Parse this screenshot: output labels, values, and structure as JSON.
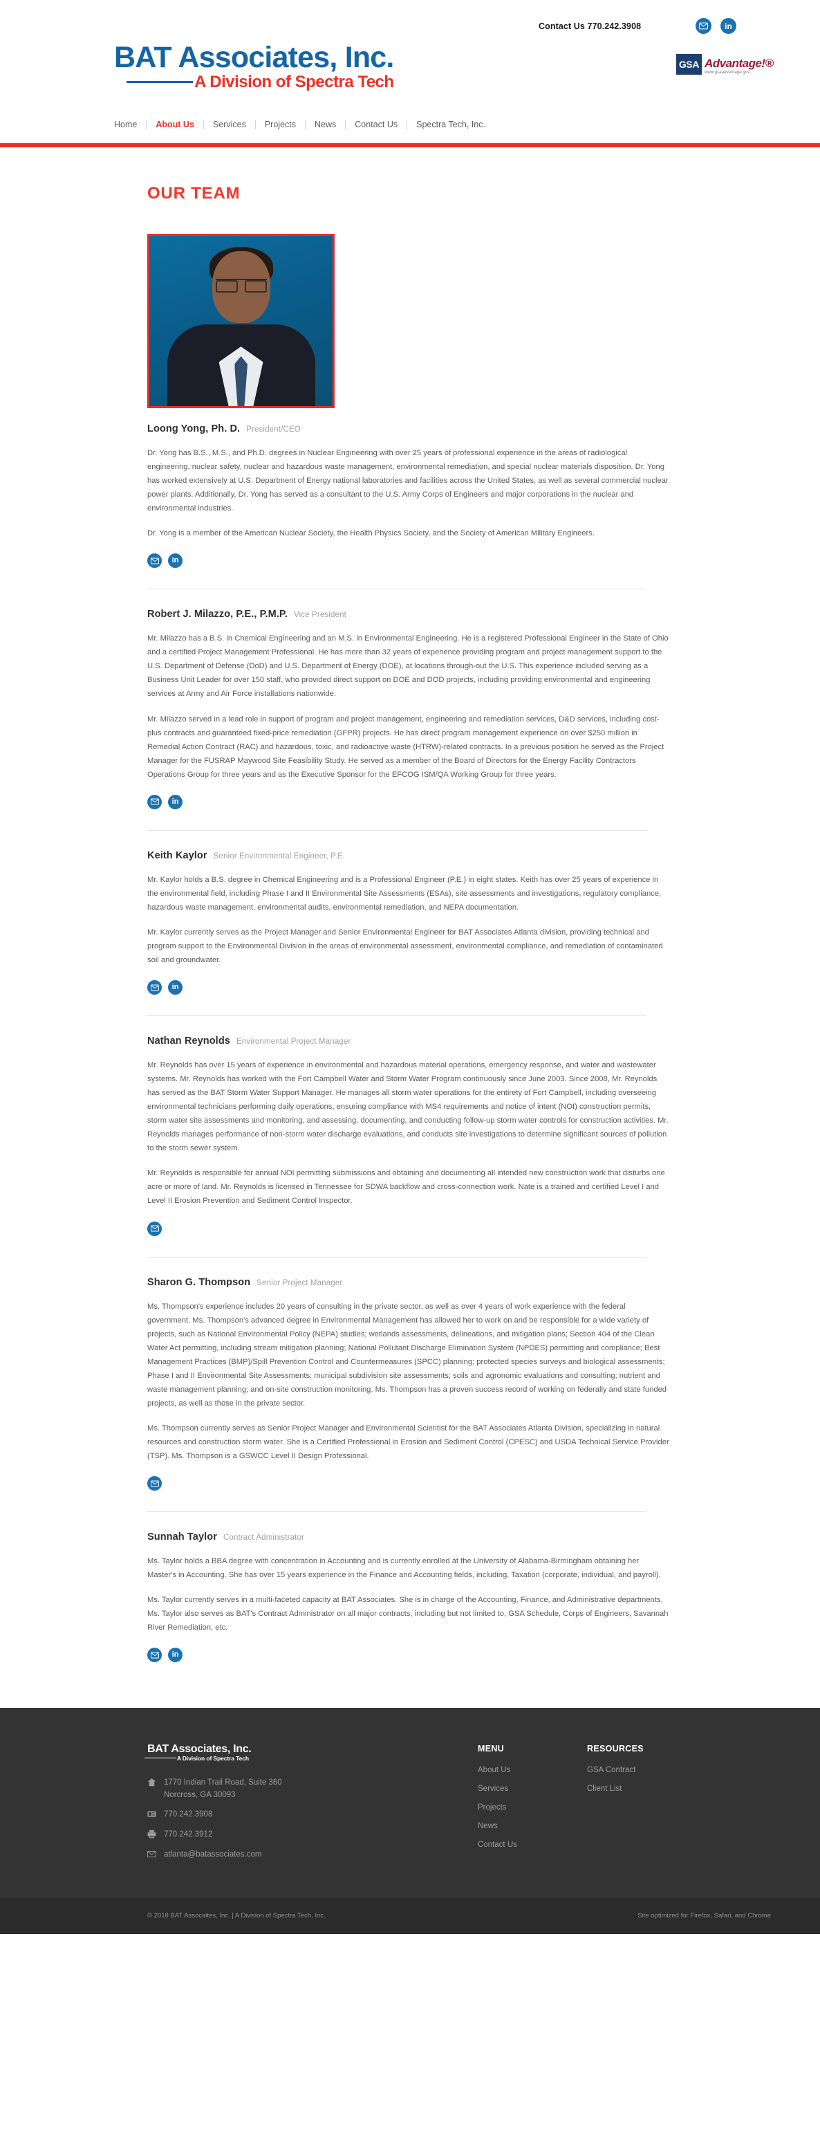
{
  "brand": {
    "logo_main": "BAT Associates, Inc.",
    "logo_sub": "A Division of Spectra Tech"
  },
  "header": {
    "contact_text": "Contact Us 770.242.3908",
    "mail_icon": "mail-icon",
    "linkedin_icon": "linkedin-icon",
    "linkedin_label": "in",
    "gsa": {
      "box_label": "GSA",
      "advantage_label": "Advantage!®",
      "url": "www.gsaadvantage.gov"
    }
  },
  "nav": {
    "items": [
      {
        "label": "Home",
        "active": false
      },
      {
        "label": "About Us",
        "active": true
      },
      {
        "label": "Services",
        "active": false
      },
      {
        "label": "Projects",
        "active": false
      },
      {
        "label": "News",
        "active": false
      },
      {
        "label": "Contact Us",
        "active": false
      },
      {
        "label": "Spectra Tech, Inc.",
        "active": false
      }
    ]
  },
  "main": {
    "page_title": "OUR TEAM"
  },
  "team": [
    {
      "name": "Loong Yong, Ph. D.",
      "role": "President/CEO",
      "has_photo": true,
      "paragraphs": [
        "Dr. Yong has B.S., M.S., and Ph.D. degrees in Nuclear Engineering with over 25 years of professional experience in the areas of radiological engineering, nuclear safety, nuclear and hazardous waste management, environmental remediation, and special nuclear materials disposition. Dr. Yong has worked extensively at U.S. Department of Energy national laboratories and facilities across the United States, as well as several commercial nuclear power plants. Additionally, Dr. Yong has served as a consultant to the U.S. Army Corps of Engineers and major corporations in the nuclear and environmental industries.",
        "Dr. Yong is a member of the American Nuclear Society, the Health Physics Society, and the Society of American Military Engineers."
      ],
      "social": [
        "mail-icon",
        "linkedin-icon"
      ]
    },
    {
      "name": "Robert J. Milazzo, P.E., P.M.P.",
      "role": "Vice President",
      "has_photo": false,
      "paragraphs": [
        "Mr. Milazzo has a B.S. in Chemical Engineering and an M.S. in Environmental Engineering. He is a registered Professional Engineer in the State of Ohio and a certified Project Management Professional. He has more than 32 years of experience providing program and project management support to the U.S. Department of Defense (DoD) and U.S. Department of Energy (DOE), at locations through-out the U.S. This experience included serving as a Business Unit Leader for over 150 staff, who provided direct support on DOE and DOD projects, including providing environmental and engineering services at Army and Air Force installations nationwide.",
        "Mr. Milazzo served in a lead role in support of program and project management, engineering and remediation services, D&D services, including cost-plus contracts and guaranteed fixed-price remediation (GFPR) projects. He has direct program management experience on over $250 million in Remedial Action Contract (RAC) and hazardous, toxic, and radioactive waste (HTRW)-related contracts. In a previous position he served as the Project Manager for the FUSRAP Maywood Site Feasibility Study. He served as a member of the Board of Directors for the Energy Facility Contractors Operations Group for three years and as the Executive Sponsor for the EFCOG ISM/QA Working Group for three years."
      ],
      "social": [
        "mail-icon",
        "linkedin-icon"
      ]
    },
    {
      "name": "Keith Kaylor",
      "role": "Senior Environmental Engineer, P.E.",
      "has_photo": false,
      "paragraphs": [
        "Mr. Kaylor holds a B.S. degree in Chemical Engineering and is a Professional Engineer (P.E.) in eight states. Keith has over 25 years of experience in the environmental field, including Phase I and II Environmental Site Assessments (ESAs), site assessments and investigations, regulatory compliance, hazardous waste management, environmental audits, environmental remediation, and NEPA documentation.",
        "Mr. Kaylor currently serves as the Project Manager and Senior Environmental Engineer for BAT Associates Atlanta division, providing technical and program support to the Environmental Division in the areas of environmental assessment, environmental compliance, and remediation of contaminated soil and groundwater."
      ],
      "social": [
        "mail-icon",
        "linkedin-icon"
      ]
    },
    {
      "name": "Nathan Reynolds",
      "role": "Environmental Project Manager",
      "has_photo": false,
      "paragraphs": [
        "Mr. Reynolds has over 15 years of experience in environmental and hazardous material operations, emergency response, and water and wastewater systems. Mr. Reynolds has worked with the Fort Campbell Water and Storm Water Program continuously since June 2003. Since 2008, Mr. Reynolds has served as the BAT Storm Water Support Manager. He manages all storm water operations for the entirety of Fort Campbell, including overseeing environmental technicians performing daily operations, ensuring compliance with MS4 requirements and notice of intent (NOI) construction permits, storm water site assessments and monitoring, and assessing, documenting, and conducting follow-up storm water controls for construction activities. Mr. Reynolds manages performance of non-storm water discharge evaluations, and conducts site investigations to determine significant sources of pollution to the storm sewer system.",
        "Mr. Reynolds is responsible for annual NOI permitting submissions and obtaining and documenting all intended new construction work that disturbs one acre or more of land. Mr. Reynolds is licensed in Tennessee for SDWA backflow and cross-connection work. Nate is a trained and certified Level I and Level II Erosion Prevention and Sediment Control Inspector."
      ],
      "social": [
        "mail-icon"
      ]
    },
    {
      "name": "Sharon G. Thompson",
      "role": "Senior Project Manager",
      "has_photo": false,
      "paragraphs": [
        "Ms. Thompson's experience includes 20 years of consulting in the private sector, as well as over 4 years of work experience with the federal government. Ms. Thompson's advanced degree in Environmental Management has allowed her to work on and be responsible for a wide variety of projects, such as National Environmental Policy (NEPA) studies; wetlands assessments, delineations, and mitigation plans; Section 404 of the Clean Water Act permitting, including stream mitigation planning; National Pollutant Discharge Elimination System (NPDES) permitting and compliance; Best Management Practices (BMP)/Spill Prevention Control and Countermeasures (SPCC) planning; protected species surveys and biological assessments; Phase I and II Environmental Site Assessments; municipal subdivision site assessments; soils and agronomic evaluations and consulting; nutrient and waste management planning; and on-site construction monitoring. Ms. Thompson has a proven success record of working on federally and state funded projects, as well as those in the private sector.",
        "Ms. Thompson currently serves as Senior Project Manager and Environmental Scientist for the BAT Associates Atlanta Division, specializing in natural resources and construction storm water. She is a Certified Professional in Erosion and Sediment Control (CPESC) and USDA Technical Service Provider (TSP). Ms. Thompson is a GSWCC Level II Design Professional."
      ],
      "social": [
        "mail-icon"
      ]
    },
    {
      "name": "Sunnah Taylor",
      "role": "Contract Administrator",
      "has_photo": false,
      "paragraphs": [
        "Ms. Taylor holds a BBA degree with concentration in Accounting and is currently enrolled at the University of Alabama-Birmingham obtaining her Master's in Accounting. She has over 15 years experience in the Finance and Accounting fields, including, Taxation (corporate, individual, and payroll).",
        "Ms. Taylor currently serves in a multi-faceted capacity at BAT Associates. She is in charge of the Accounting, Finance, and Administrative departments. Ms. Taylor also serves as BAT's Contract Administrator on all major contracts, including but not limited to, GSA Schedule, Corps of Engineers, Savannah River Remediation, etc."
      ],
      "social": [
        "mail-icon",
        "linkedin-icon"
      ]
    }
  ],
  "footer": {
    "address_line1": "1770 Indian Trail Road, Suite 360",
    "address_line2": "Norcross, GA 30093",
    "phone": "770.242.3908",
    "fax": "770.242.3912",
    "email": "atlanta@batassociates.com",
    "menu_heading": "MENU",
    "menu_items": [
      "About Us",
      "Services",
      "Projects",
      "News",
      "Contact Us"
    ],
    "resources_heading": "RESOURCES",
    "resources_items": [
      "GSA Contract",
      "Client List"
    ],
    "copyright": "© 2018 BAT Assocaites, Inc. | A Division of Spectra Tech, Inc.",
    "optimized": "Site optimized for Firefox, Safari, and Chrome"
  },
  "colors": {
    "brand_blue": "#1565a5",
    "brand_red": "#ee2c24",
    "social_blue": "#1b72b0",
    "footer_bg": "#333333"
  }
}
